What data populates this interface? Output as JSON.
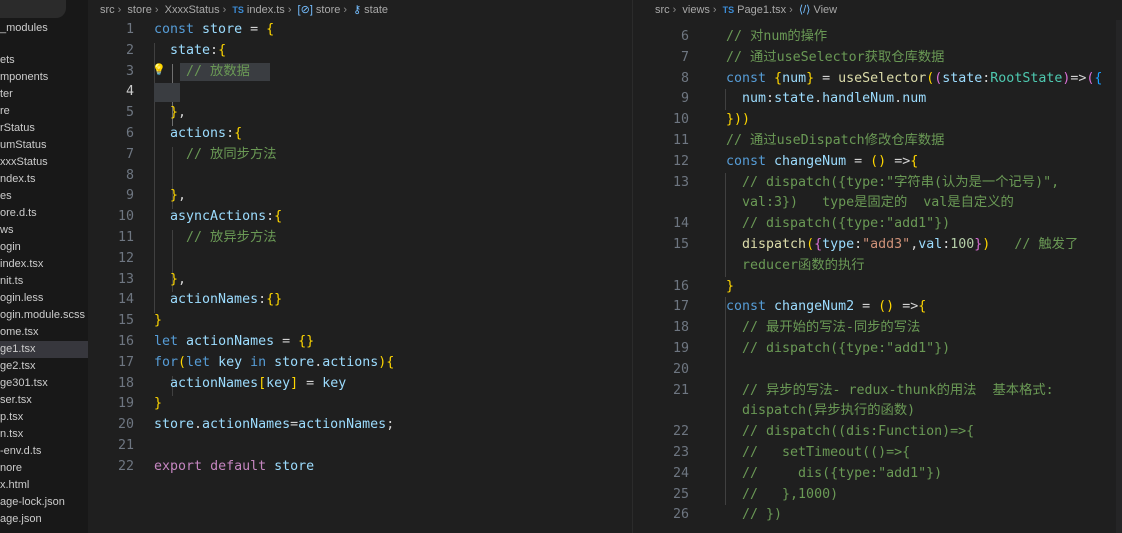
{
  "sidebar": {
    "items": [
      {
        "label": "_modules",
        "active": false
      },
      {
        "label": "ets",
        "active": false
      },
      {
        "label": "mponents",
        "active": false
      },
      {
        "label": "ter",
        "active": false
      },
      {
        "label": "re",
        "active": false
      },
      {
        "label": "rStatus",
        "active": false
      },
      {
        "label": "umStatus",
        "active": false
      },
      {
        "label": "xxxStatus",
        "active": false
      },
      {
        "label": "ndex.ts",
        "active": false
      },
      {
        "label": "es",
        "active": false
      },
      {
        "label": "ore.d.ts",
        "active": false
      },
      {
        "label": "ws",
        "active": false
      },
      {
        "label": "ogin",
        "active": false
      },
      {
        "label": "index.tsx",
        "active": false
      },
      {
        "label": "nit.ts",
        "active": false
      },
      {
        "label": "ogin.less",
        "active": false
      },
      {
        "label": "ogin.module.scss",
        "active": false
      },
      {
        "label": "ome.tsx",
        "active": false
      },
      {
        "label": "ge1.tsx",
        "active": true
      },
      {
        "label": "ge2.tsx",
        "active": false
      },
      {
        "label": "ge301.tsx",
        "active": false
      },
      {
        "label": "ser.tsx",
        "active": false
      },
      {
        "label": "p.tsx",
        "active": false
      },
      {
        "label": "n.tsx",
        "active": false
      },
      {
        "label": "-env.d.ts",
        "active": false
      },
      {
        "label": "nore",
        "active": false
      },
      {
        "label": "x.html",
        "active": false
      },
      {
        "label": "age-lock.json",
        "active": false
      },
      {
        "label": "age.json",
        "active": false
      }
    ]
  },
  "left_editor": {
    "breadcrumb": {
      "p1": "src",
      "p2": "store",
      "p3": "XxxxStatus",
      "file_badge": "TS",
      "file": "index.ts",
      "sym_badge": "[⊘]",
      "symbol": "store",
      "prop_badge": "⚷",
      "prop": "state"
    },
    "lines": [
      {
        "n": "1",
        "code": "const store = {"
      },
      {
        "n": "2",
        "code": "  state:{"
      },
      {
        "n": "3",
        "code": "    // 放数据"
      },
      {
        "n": "4",
        "code": "    "
      },
      {
        "n": "5",
        "code": "  },"
      },
      {
        "n": "6",
        "code": "  actions:{"
      },
      {
        "n": "7",
        "code": "    // 放同步方法"
      },
      {
        "n": "8",
        "code": ""
      },
      {
        "n": "9",
        "code": "  },"
      },
      {
        "n": "10",
        "code": "  asyncActions:{"
      },
      {
        "n": "11",
        "code": "    // 放异步方法"
      },
      {
        "n": "12",
        "code": ""
      },
      {
        "n": "13",
        "code": "  },"
      },
      {
        "n": "14",
        "code": "  actionNames:{}"
      },
      {
        "n": "15",
        "code": "}"
      },
      {
        "n": "16",
        "code": "let actionNames = {}"
      },
      {
        "n": "17",
        "code": "for(let key in store.actions){"
      },
      {
        "n": "18",
        "code": "  actionNames[key] = key"
      },
      {
        "n": "19",
        "code": "}"
      },
      {
        "n": "20",
        "code": "store.actionNames=actionNames;"
      },
      {
        "n": "21",
        "code": ""
      },
      {
        "n": "22",
        "code": "export default store"
      }
    ],
    "current_line": "4"
  },
  "right_editor": {
    "breadcrumb": {
      "p1": "src",
      "p2": "views",
      "file_badge": "TS",
      "file": "Page1.tsx",
      "sym_badge": "⟨/⟩",
      "symbol": "View"
    },
    "lines": [
      {
        "n": "6",
        "code": "// 对num的操作"
      },
      {
        "n": "7",
        "code": "// 通过useSelector获取仓库数据"
      },
      {
        "n": "8",
        "code": "const {num} = useSelector((state:RootState)=>({"
      },
      {
        "n": "9",
        "code": "  num:state.handleNum.num"
      },
      {
        "n": "10",
        "code": "}))"
      },
      {
        "n": "11",
        "code": "// 通过useDispatch修改仓库数据"
      },
      {
        "n": "12",
        "code": "const changeNum = () =>{"
      },
      {
        "n": "13",
        "code": "  // dispatch({type:\"字符串(认为是一个记号)\","
      },
      {
        "n": "",
        "code": "  val:3})   type是固定的  val是自定义的"
      },
      {
        "n": "14",
        "code": "  // dispatch({type:\"add1\"})"
      },
      {
        "n": "15",
        "code": "  dispatch({type:\"add3\",val:100})   // 触发了"
      },
      {
        "n": "",
        "code": "  reducer函数的执行"
      },
      {
        "n": "16",
        "code": "}"
      },
      {
        "n": "17",
        "code": "const changeNum2 = () =>{"
      },
      {
        "n": "18",
        "code": "  // 最开始的写法-同步的写法"
      },
      {
        "n": "19",
        "code": "  // dispatch({type:\"add1\"})"
      },
      {
        "n": "20",
        "code": ""
      },
      {
        "n": "21",
        "code": "  // 异步的写法- redux-thunk的用法  基本格式:"
      },
      {
        "n": "",
        "code": "  dispatch(异步执行的函数)"
      },
      {
        "n": "22",
        "code": "  // dispatch((dis:Function)=>{"
      },
      {
        "n": "23",
        "code": "  //   setTimeout(()=>{"
      },
      {
        "n": "24",
        "code": "  //     dis({type:\"add1\"})"
      },
      {
        "n": "25",
        "code": "  //   },1000)"
      },
      {
        "n": "26",
        "code": "  // })"
      }
    ]
  },
  "colors": {
    "background": "#1f1f1f",
    "keyword": "#569cd6",
    "variable": "#9cdcfe",
    "comment": "#6a9955",
    "string": "#ce9178"
  }
}
